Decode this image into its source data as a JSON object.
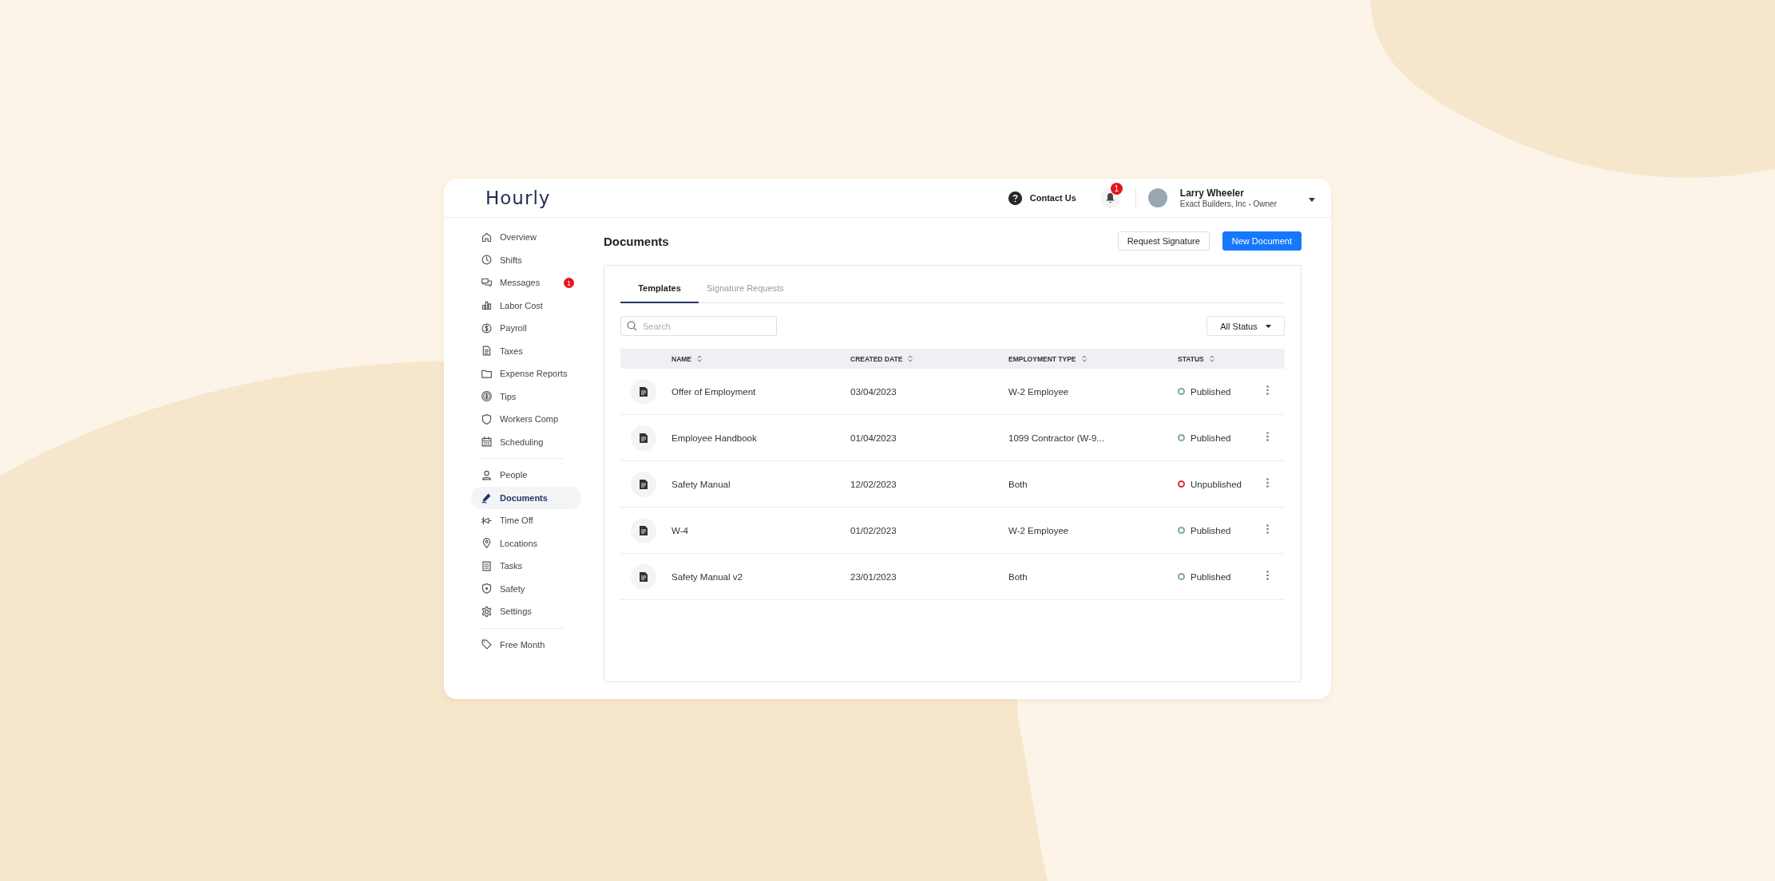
{
  "header": {
    "logo": "Hourly",
    "contact": "Contact Us",
    "notifications": "1",
    "user": {
      "name": "Larry Wheeler",
      "subtitle": "Exact Builders, Inc - Owner"
    }
  },
  "sidebar": {
    "sections": [
      {
        "items": [
          {
            "label": "Overview",
            "selected": false
          },
          {
            "label": "Shifts",
            "selected": false
          },
          {
            "label": "Messages",
            "selected": false,
            "badge": "1"
          },
          {
            "label": "Labor Cost",
            "selected": false
          },
          {
            "label": "Payroll",
            "selected": false
          },
          {
            "label": "Taxes",
            "selected": false
          },
          {
            "label": "Expense Reports",
            "selected": false
          },
          {
            "label": "Tips",
            "selected": false
          },
          {
            "label": "Workers Comp",
            "selected": false
          },
          {
            "label": "Scheduling",
            "selected": false
          }
        ]
      },
      {
        "items": [
          {
            "label": "People",
            "selected": false
          },
          {
            "label": "Documents",
            "selected": true
          },
          {
            "label": "Time Off",
            "selected": false
          },
          {
            "label": "Locations",
            "selected": false
          },
          {
            "label": "Tasks",
            "selected": false
          },
          {
            "label": "Safety",
            "selected": false
          },
          {
            "label": "Settings",
            "selected": false
          }
        ]
      },
      {
        "items": [
          {
            "label": "Free Month",
            "selected": false
          }
        ]
      }
    ]
  },
  "page": {
    "title": "Documents",
    "buttons": [
      {
        "label": "Request Signature",
        "kind": "secondary"
      },
      {
        "label": "New Document",
        "kind": "primary"
      }
    ]
  },
  "tabs": [
    {
      "label": "Templates",
      "selected": true
    },
    {
      "label": "Signature Requests",
      "selected": false
    }
  ],
  "search": {
    "placeholder": "Search"
  },
  "filter": {
    "value": "All Status"
  },
  "table": {
    "columns": [
      "NAME",
      "CREATED DATE",
      "EMPLOYMENT TYPE",
      "STATUS"
    ],
    "rows": [
      {
        "name": "Offer of Employment",
        "created_date": "03/04/2023",
        "employment_type": "W-2 Employee",
        "status": "Published",
        "color": "#7fa89c"
      },
      {
        "name": "Employee Handbook",
        "created_date": "01/04/2023",
        "employment_type": "1099 Contractor (W-9...",
        "status": "Published",
        "color": "#7fa89c"
      },
      {
        "name": "Safety Manual",
        "created_date": "12/02/2023",
        "employment_type": "Both",
        "status": "Unpublished",
        "color": "#e0312b"
      },
      {
        "name": "W-4",
        "created_date": "01/02/2023",
        "employment_type": "W-2 Employee",
        "status": "Published",
        "color": "#7fa89c"
      },
      {
        "name": "Safety Manual v2",
        "created_date": "23/01/2023",
        "employment_type": "Both",
        "status": "Published",
        "color": "#7fa89c"
      }
    ]
  }
}
